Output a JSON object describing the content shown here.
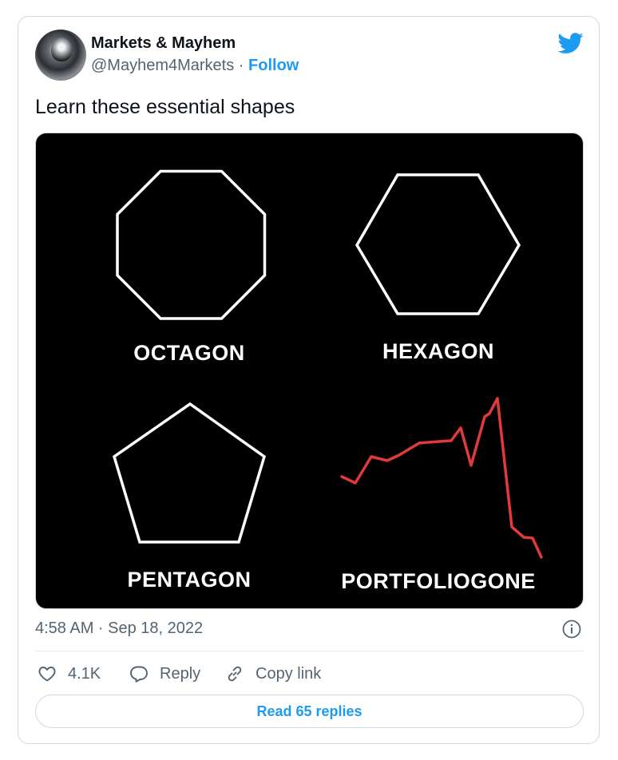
{
  "author": {
    "name": "Markets & Mayhem",
    "handle": "@Mayhem4Markets",
    "separator": " · ",
    "follow_label": "Follow"
  },
  "tweet": {
    "text": "Learn these essential shapes",
    "timestamp": "4:58 AM · Sep 18, 2022"
  },
  "media": {
    "labels": {
      "octagon": "OCTAGON",
      "hexagon": "HEXAGON",
      "pentagon": "PENTAGON",
      "portfolio": "PORTFOLIOGONE"
    },
    "background_color": "#000000",
    "outline_color": "#ffffff",
    "line_color": "#e03a3a"
  },
  "actions": {
    "likes": "4.1K",
    "reply_label": "Reply",
    "copy_link_label": "Copy link",
    "read_replies_label": "Read 65 replies"
  },
  "icons": [
    "twitter-bird-icon",
    "info-icon",
    "heart-icon",
    "reply-icon",
    "link-icon"
  ],
  "colors": {
    "accent": "#1d9bf0",
    "secondary_text": "#536471",
    "border": "#cfd9de"
  }
}
